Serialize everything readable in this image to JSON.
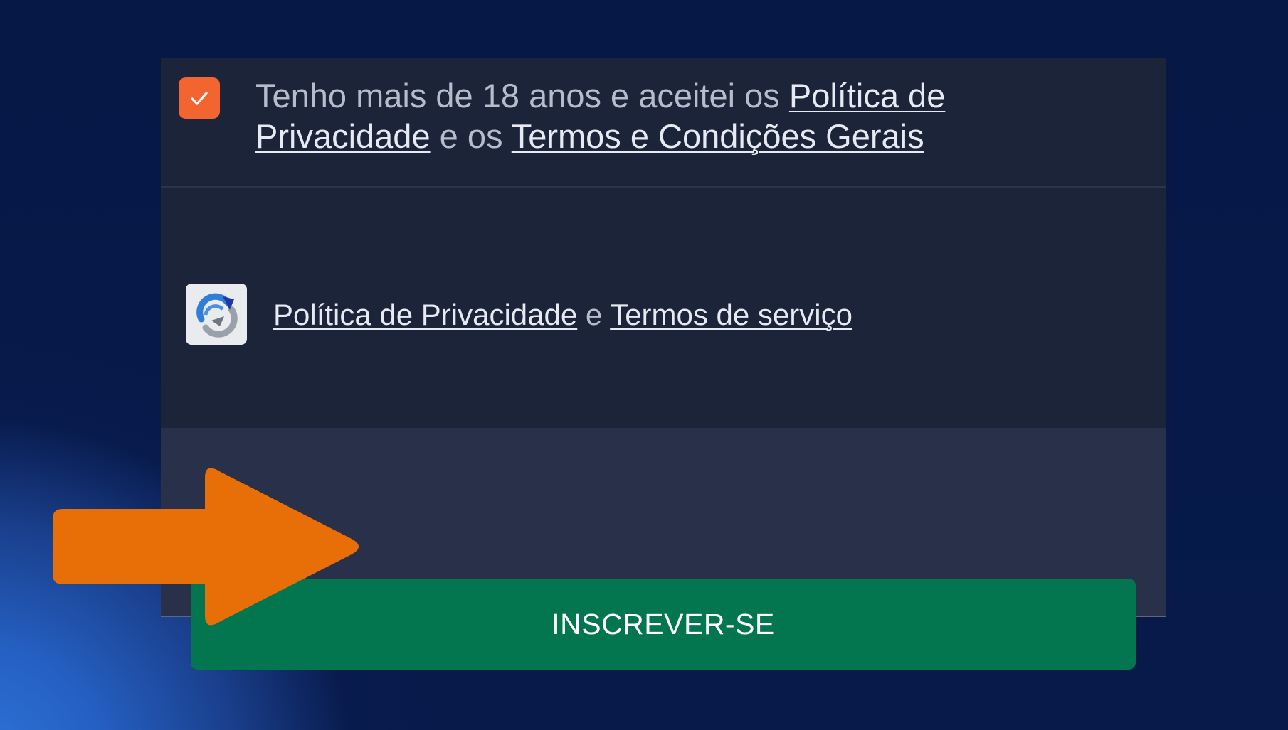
{
  "consent": {
    "checked": true,
    "prefix": "Tenho mais de 18 anos e aceitei os ",
    "privacy_link": "Política de Privacidade",
    "middle": " e os ",
    "terms_link": "Termos e Condições Gerais"
  },
  "captcha": {
    "privacy_link": "Política de Privacidade",
    "connector": " e ",
    "terms_link": "Termos de serviço"
  },
  "actions": {
    "submit_label": "INSCREVER-SE"
  },
  "colors": {
    "checkbox": "#f26430",
    "button": "#03764f",
    "arrow": "#e86f08",
    "panel": "#1c2439",
    "background": "#051846"
  },
  "icons": {
    "checkbox": "checkmark-icon",
    "captcha": "recaptcha-logo-icon",
    "annotation": "arrow-right-icon"
  }
}
